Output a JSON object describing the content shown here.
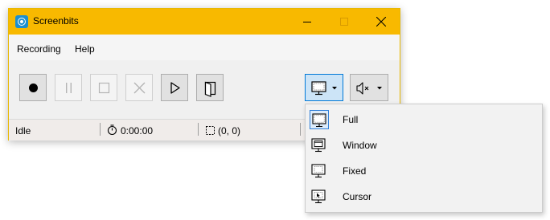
{
  "window": {
    "title": "Screenbits"
  },
  "menu": {
    "items": [
      "Recording",
      "Help"
    ]
  },
  "status": {
    "state": "Idle",
    "time": "0:00:00",
    "coords": "(0, 0)"
  },
  "dropdown": {
    "items": [
      {
        "label": "Full",
        "selected": true
      },
      {
        "label": "Window"
      },
      {
        "label": "Fixed"
      },
      {
        "label": "Cursor"
      }
    ]
  },
  "colors": {
    "titlebar": "#f8b900",
    "accent": "#0078d7",
    "icon": "#1d8fd0"
  }
}
